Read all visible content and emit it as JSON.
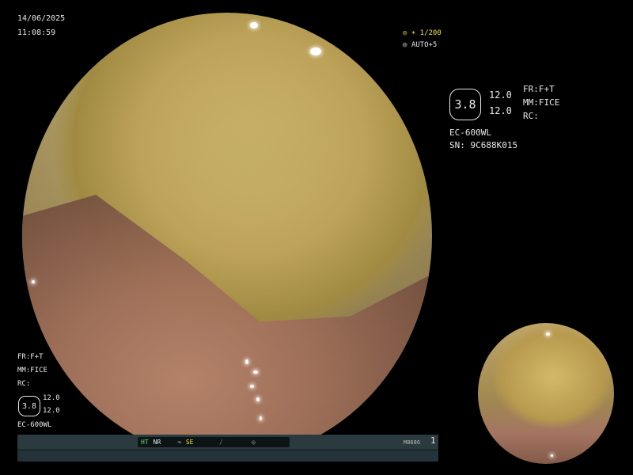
{
  "overlay": {
    "date": "14/06/2025",
    "time": "11:08:59",
    "shutter": "∗ 1/200",
    "auto": "AUTO+5",
    "info": {
      "fr": "FR:F+T",
      "mm": "MM:FICE",
      "rc": "RC:",
      "badge_value": "3.8",
      "val1": "12.0",
      "val2": "12.0",
      "scope_model": "EC-600WL",
      "serial": "SN: 9C688K015"
    },
    "left_info": {
      "fr": "FR:F+T",
      "mm": "MM:FICE",
      "rc": "RC:",
      "badge_value": "3.8",
      "val1": "12.0",
      "val2": "12.0",
      "scope_model": "EC-600WL"
    }
  },
  "statusbar": {
    "ht": "HT",
    "nr": "NR",
    "se": "SE",
    "code": "M8686",
    "page": "1"
  },
  "colors": {
    "mucus": "#bda259",
    "mucosa": "#a06e5a",
    "status_green": "#5fe07a",
    "status_yellow": "#f0e23a"
  }
}
